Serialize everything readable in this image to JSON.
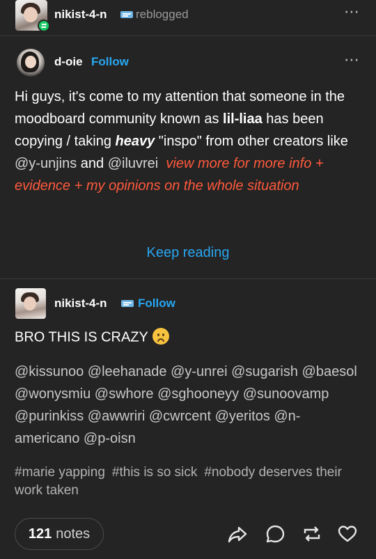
{
  "header": {
    "username": "nikist-4-n",
    "action": "reblogged",
    "more_icon": "⋯"
  },
  "original_post": {
    "username": "d-oie",
    "follow": "Follow",
    "more_icon": "⋯",
    "text": {
      "p1": "Hi guys, it's come to my attention that someone in the moodboard community known as ",
      "bold_name": "lil-liaa",
      "p2": " has been copying / taking ",
      "heavy": "heavy",
      "p3": " \"inspo\" from other creators like ",
      "mention1": "@y-unjins",
      "p4": " and ",
      "mention2": "@iluvrei",
      "red": "view more for more info + evidence + my opinions on the whole situation"
    },
    "keep_reading": "Keep reading"
  },
  "reply": {
    "username": "nikist-4-n",
    "follow": "Follow",
    "text": "BRO THIS IS CRAZY",
    "mentions": "@kissunoo @leehanade @y-unrei @sugarish @baesol @wonysmiu @swhore @sghooneyy @sunoovamp @purinkiss @awwriri @cwrcent @yeritos @n-americano @p-oisn",
    "tags": [
      "#marie yapping",
      "#this is so sick",
      "#nobody deserves their work taken"
    ]
  },
  "footer": {
    "notes_count": "121",
    "notes_label": "notes"
  },
  "colors": {
    "background": "#242424",
    "link_blue": "#28a7f2",
    "red_text": "#ff5a3c",
    "reblog_green": "#17c964"
  }
}
